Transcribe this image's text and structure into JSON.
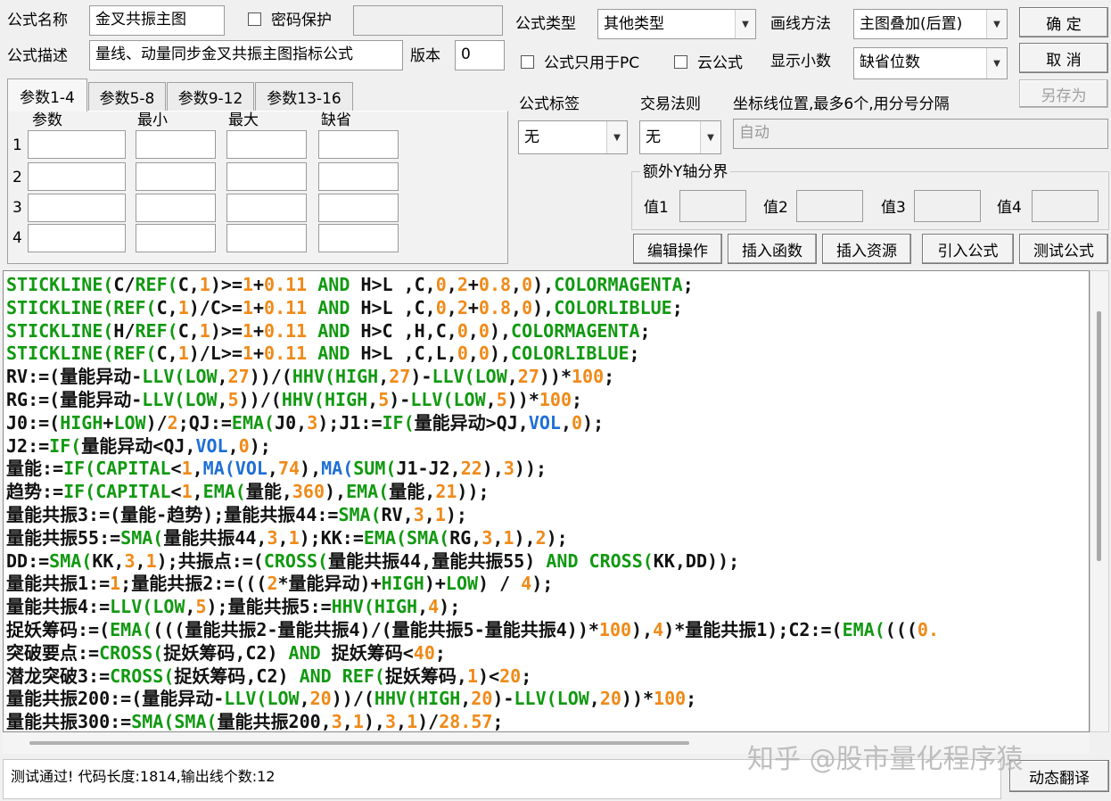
{
  "form": {
    "name_label": "公式名称",
    "name_value": "金叉共振主图",
    "password_label": "密码保护",
    "desc_label": "公式描述",
    "desc_value": "量线、动量同步金叉共振主图指标公式",
    "version_label": "版本",
    "version_value": "0",
    "type_label": "公式类型",
    "type_value": "其他类型",
    "draw_label": "画线方法",
    "draw_value": "主图叠加(后置)",
    "pc_only_label": "公式只用于PC",
    "cloud_label": "云公式",
    "decimal_label": "显示小数",
    "decimal_value": "缺省位数",
    "tag_label": "公式标签",
    "tag_value": "无",
    "rule_label": "交易法则",
    "rule_value": "无",
    "coord_label": "坐标线位置,最多6个,用分号分隔",
    "coord_value": "自动",
    "extra_y_label": "额外Y轴分界",
    "v1": "值1",
    "v2": "值2",
    "v3": "值3",
    "v4": "值4"
  },
  "buttons": {
    "ok": "确  定",
    "cancel": "取  消",
    "save_as": "另存为",
    "edit": "编辑操作",
    "insert_func": "插入函数",
    "insert_res": "插入资源",
    "import": "引入公式",
    "test": "测试公式",
    "translate": "动态翻译"
  },
  "params": {
    "tabs": [
      "参数1-4",
      "参数5-8",
      "参数9-12",
      "参数13-16"
    ],
    "headers": [
      "参数",
      "最小",
      "最大",
      "缺省"
    ],
    "rows": [
      "1",
      "2",
      "3",
      "4"
    ]
  },
  "code_lines": [
    [
      [
        "g",
        "STICKLINE("
      ],
      [
        "k",
        "C/"
      ],
      [
        "g",
        "REF("
      ],
      [
        "k",
        "C,"
      ],
      [
        "o",
        "1"
      ],
      [
        "k",
        ")>="
      ],
      [
        "o",
        "1"
      ],
      [
        "k",
        "+"
      ],
      [
        "o",
        "0.11"
      ],
      [
        "g",
        " AND "
      ],
      [
        "k",
        "H>L ,C,"
      ],
      [
        "o",
        "0"
      ],
      [
        "k",
        ","
      ],
      [
        "o",
        "2"
      ],
      [
        "k",
        "+"
      ],
      [
        "o",
        "0.8"
      ],
      [
        "k",
        ","
      ],
      [
        "o",
        "0"
      ],
      [
        "k",
        "),"
      ],
      [
        "g",
        "COLORMAGENTA"
      ],
      [
        "k",
        ";"
      ]
    ],
    [
      [
        "g",
        "STICKLINE("
      ],
      [
        "g",
        "REF("
      ],
      [
        "k",
        "C,"
      ],
      [
        "o",
        "1"
      ],
      [
        "k",
        ")/C>="
      ],
      [
        "o",
        "1"
      ],
      [
        "k",
        "+"
      ],
      [
        "o",
        "0.11"
      ],
      [
        "g",
        " AND "
      ],
      [
        "k",
        "H>L ,C,"
      ],
      [
        "o",
        "0"
      ],
      [
        "k",
        ","
      ],
      [
        "o",
        "2"
      ],
      [
        "k",
        "+"
      ],
      [
        "o",
        "0.8"
      ],
      [
        "k",
        ","
      ],
      [
        "o",
        "0"
      ],
      [
        "k",
        "),"
      ],
      [
        "g",
        "COLORLIBLUE"
      ],
      [
        "k",
        ";"
      ]
    ],
    [
      [
        "g",
        "STICKLINE("
      ],
      [
        "k",
        "H/"
      ],
      [
        "g",
        "REF("
      ],
      [
        "k",
        "C,"
      ],
      [
        "o",
        "1"
      ],
      [
        "k",
        ")>="
      ],
      [
        "o",
        "1"
      ],
      [
        "k",
        "+"
      ],
      [
        "o",
        "0.11"
      ],
      [
        "g",
        " AND "
      ],
      [
        "k",
        "H>C ,H,C,"
      ],
      [
        "o",
        "0"
      ],
      [
        "k",
        ","
      ],
      [
        "o",
        "0"
      ],
      [
        "k",
        "),"
      ],
      [
        "g",
        "COLORMAGENTA"
      ],
      [
        "k",
        ";"
      ]
    ],
    [
      [
        "g",
        "STICKLINE("
      ],
      [
        "g",
        "REF("
      ],
      [
        "k",
        "C,"
      ],
      [
        "o",
        "1"
      ],
      [
        "k",
        ")/L>="
      ],
      [
        "o",
        "1"
      ],
      [
        "k",
        "+"
      ],
      [
        "o",
        "0.11"
      ],
      [
        "g",
        " AND "
      ],
      [
        "k",
        "H>L ,C,L,"
      ],
      [
        "o",
        "0"
      ],
      [
        "k",
        ","
      ],
      [
        "o",
        "0"
      ],
      [
        "k",
        "),"
      ],
      [
        "g",
        "COLORLIBLUE"
      ],
      [
        "k",
        ";"
      ]
    ],
    [
      [
        "k",
        "RV:=(量能异动-"
      ],
      [
        "g",
        "LLV("
      ],
      [
        "g",
        "LOW"
      ],
      [
        "k",
        ","
      ],
      [
        "o",
        "27"
      ],
      [
        "k",
        "))/("
      ],
      [
        "g",
        "HHV("
      ],
      [
        "g",
        "HIGH"
      ],
      [
        "k",
        ","
      ],
      [
        "o",
        "27"
      ],
      [
        "k",
        ")-"
      ],
      [
        "g",
        "LLV("
      ],
      [
        "g",
        "LOW"
      ],
      [
        "k",
        ","
      ],
      [
        "o",
        "27"
      ],
      [
        "k",
        "))*"
      ],
      [
        "o",
        "100"
      ],
      [
        "k",
        ";"
      ]
    ],
    [
      [
        "k",
        "RG:=(量能异动-"
      ],
      [
        "g",
        "LLV("
      ],
      [
        "g",
        "LOW"
      ],
      [
        "k",
        ","
      ],
      [
        "o",
        "5"
      ],
      [
        "k",
        "))/("
      ],
      [
        "g",
        "HHV("
      ],
      [
        "g",
        "HIGH"
      ],
      [
        "k",
        ","
      ],
      [
        "o",
        "5"
      ],
      [
        "k",
        ")-"
      ],
      [
        "g",
        "LLV("
      ],
      [
        "g",
        "LOW"
      ],
      [
        "k",
        ","
      ],
      [
        "o",
        "5"
      ],
      [
        "k",
        "))*"
      ],
      [
        "o",
        "100"
      ],
      [
        "k",
        ";"
      ]
    ],
    [
      [
        "k",
        "J0:=("
      ],
      [
        "g",
        "HIGH"
      ],
      [
        "k",
        "+"
      ],
      [
        "g",
        "LOW"
      ],
      [
        "k",
        ")/"
      ],
      [
        "o",
        "2"
      ],
      [
        "k",
        ";QJ:="
      ],
      [
        "g",
        "EMA("
      ],
      [
        "k",
        "J0,"
      ],
      [
        "o",
        "3"
      ],
      [
        "k",
        ");J1:="
      ],
      [
        "g",
        "IF("
      ],
      [
        "k",
        "量能异动>QJ,"
      ],
      [
        "b",
        "VOL"
      ],
      [
        "k",
        ","
      ],
      [
        "o",
        "0"
      ],
      [
        "k",
        ");"
      ]
    ],
    [
      [
        "k",
        "J2:="
      ],
      [
        "g",
        "IF("
      ],
      [
        "k",
        "量能异动<QJ,"
      ],
      [
        "b",
        "VOL"
      ],
      [
        "k",
        ","
      ],
      [
        "o",
        "0"
      ],
      [
        "k",
        ");"
      ]
    ],
    [
      [
        "k",
        "量能:="
      ],
      [
        "g",
        "IF("
      ],
      [
        "g",
        "CAPITAL"
      ],
      [
        "k",
        "<"
      ],
      [
        "o",
        "1"
      ],
      [
        "k",
        ","
      ],
      [
        "b",
        "MA("
      ],
      [
        "b",
        "VOL"
      ],
      [
        "k",
        ","
      ],
      [
        "o",
        "74"
      ],
      [
        "k",
        "),"
      ],
      [
        "b",
        "MA("
      ],
      [
        "g",
        "SUM("
      ],
      [
        "k",
        "J1-J2,"
      ],
      [
        "o",
        "22"
      ],
      [
        "k",
        "),"
      ],
      [
        "o",
        "3"
      ],
      [
        "k",
        "));"
      ]
    ],
    [
      [
        "k",
        "趋势:="
      ],
      [
        "g",
        "IF("
      ],
      [
        "g",
        "CAPITAL"
      ],
      [
        "k",
        "<"
      ],
      [
        "o",
        "1"
      ],
      [
        "k",
        ","
      ],
      [
        "g",
        "EMA("
      ],
      [
        "k",
        "量能,"
      ],
      [
        "o",
        "360"
      ],
      [
        "k",
        "),"
      ],
      [
        "g",
        "EMA("
      ],
      [
        "k",
        "量能,"
      ],
      [
        "o",
        "21"
      ],
      [
        "k",
        "));"
      ]
    ],
    [
      [
        "k",
        "量能共振3:=(量能-趋势);量能共振44:="
      ],
      [
        "g",
        "SMA("
      ],
      [
        "k",
        "RV,"
      ],
      [
        "o",
        "3"
      ],
      [
        "k",
        ","
      ],
      [
        "o",
        "1"
      ],
      [
        "k",
        ");"
      ]
    ],
    [
      [
        "k",
        "量能共振55:="
      ],
      [
        "g",
        "SMA("
      ],
      [
        "k",
        "量能共振44,"
      ],
      [
        "o",
        "3"
      ],
      [
        "k",
        ","
      ],
      [
        "o",
        "1"
      ],
      [
        "k",
        ");KK:="
      ],
      [
        "g",
        "EMA("
      ],
      [
        "g",
        "SMA("
      ],
      [
        "k",
        "RG,"
      ],
      [
        "o",
        "3"
      ],
      [
        "k",
        ","
      ],
      [
        "o",
        "1"
      ],
      [
        "k",
        "),"
      ],
      [
        "o",
        "2"
      ],
      [
        "k",
        ");"
      ]
    ],
    [
      [
        "k",
        "DD:="
      ],
      [
        "g",
        "SMA("
      ],
      [
        "k",
        "KK,"
      ],
      [
        "o",
        "3"
      ],
      [
        "k",
        ","
      ],
      [
        "o",
        "1"
      ],
      [
        "k",
        ");共振点:=("
      ],
      [
        "g",
        "CROSS("
      ],
      [
        "k",
        "量能共振44,量能共振55)"
      ],
      [
        "g",
        " AND "
      ],
      [
        "g",
        "CROSS("
      ],
      [
        "k",
        "KK,DD));"
      ]
    ],
    [
      [
        "k",
        "量能共振1:="
      ],
      [
        "o",
        "1"
      ],
      [
        "k",
        ";量能共振2:=((("
      ],
      [
        "o",
        "2"
      ],
      [
        "k",
        "*量能异动)+"
      ],
      [
        "g",
        "HIGH"
      ],
      [
        "k",
        ")+"
      ],
      [
        "g",
        "LOW"
      ],
      [
        "k",
        ") / "
      ],
      [
        "o",
        "4"
      ],
      [
        "k",
        ");"
      ]
    ],
    [
      [
        "k",
        "量能共振4:="
      ],
      [
        "g",
        "LLV("
      ],
      [
        "g",
        "LOW"
      ],
      [
        "k",
        ","
      ],
      [
        "o",
        "5"
      ],
      [
        "k",
        ");量能共振5:="
      ],
      [
        "g",
        "HHV("
      ],
      [
        "g",
        "HIGH"
      ],
      [
        "k",
        ","
      ],
      [
        "o",
        "4"
      ],
      [
        "k",
        ");"
      ]
    ],
    [
      [
        "k",
        "捉妖筹码:=("
      ],
      [
        "g",
        "EMA("
      ],
      [
        "k",
        "(((量能共振2-量能共振4)/(量能共振5-量能共振4))*"
      ],
      [
        "o",
        "100"
      ],
      [
        "k",
        "),"
      ],
      [
        "o",
        "4"
      ],
      [
        "k",
        ")*量能共振1);C2:=("
      ],
      [
        "g",
        "EMA("
      ],
      [
        "k",
        "((("
      ],
      [
        "o",
        "0."
      ]
    ],
    [
      [
        "k",
        "突破要点:="
      ],
      [
        "g",
        "CROSS("
      ],
      [
        "k",
        "捉妖筹码,C2)"
      ],
      [
        "g",
        " AND "
      ],
      [
        "k",
        "捉妖筹码<"
      ],
      [
        "o",
        "40"
      ],
      [
        "k",
        ";"
      ]
    ],
    [
      [
        "k",
        "潜龙突破3:="
      ],
      [
        "g",
        "CROSS("
      ],
      [
        "k",
        "捉妖筹码,C2)"
      ],
      [
        "g",
        " AND "
      ],
      [
        "g",
        "REF("
      ],
      [
        "k",
        "捉妖筹码,"
      ],
      [
        "o",
        "1"
      ],
      [
        "k",
        ")<"
      ],
      [
        "o",
        "20"
      ],
      [
        "k",
        ";"
      ]
    ],
    [
      [
        "k",
        "量能共振200:=(量能异动-"
      ],
      [
        "g",
        "LLV("
      ],
      [
        "g",
        "LOW"
      ],
      [
        "k",
        ","
      ],
      [
        "o",
        "20"
      ],
      [
        "k",
        "))/("
      ],
      [
        "g",
        "HHV("
      ],
      [
        "g",
        "HIGH"
      ],
      [
        "k",
        ","
      ],
      [
        "o",
        "20"
      ],
      [
        "k",
        ")-"
      ],
      [
        "g",
        "LLV("
      ],
      [
        "g",
        "LOW"
      ],
      [
        "k",
        ","
      ],
      [
        "o",
        "20"
      ],
      [
        "k",
        "))*"
      ],
      [
        "o",
        "100"
      ],
      [
        "k",
        ";"
      ]
    ],
    [
      [
        "k",
        "量能共振300:="
      ],
      [
        "g",
        "SMA("
      ],
      [
        "g",
        "SMA("
      ],
      [
        "k",
        "量能共振200,"
      ],
      [
        "o",
        "3"
      ],
      [
        "k",
        ","
      ],
      [
        "o",
        "1"
      ],
      [
        "k",
        "),"
      ],
      [
        "o",
        "3"
      ],
      [
        "k",
        ","
      ],
      [
        "o",
        "1"
      ],
      [
        "k",
        ")/"
      ],
      [
        "o",
        "28.57"
      ],
      [
        "k",
        ";"
      ]
    ]
  ],
  "status_text": "测试通过! 代码长度:1814,输出线个数:12",
  "watermark": "知乎 @股市量化程序猿"
}
